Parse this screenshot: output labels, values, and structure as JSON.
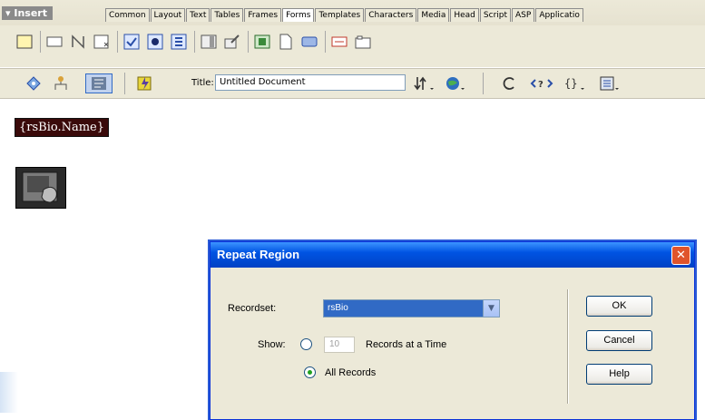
{
  "insert_bar": {
    "label": "Insert",
    "tabs": [
      "Common",
      "Layout",
      "Text",
      "Tables",
      "Frames",
      "Forms",
      "Templates",
      "Characters",
      "Media",
      "Head",
      "Script",
      "ASP",
      "Applicatio"
    ],
    "active_tab": "Forms"
  },
  "doc_toolbar": {
    "title_label": "Title:",
    "title_value": "Untitled Document"
  },
  "document": {
    "dynamic_text": "{rsBio.Name}"
  },
  "dialog": {
    "title": "Repeat Region",
    "close_glyph": "✕",
    "recordset_label": "Recordset:",
    "recordset_value": "rsBio",
    "show_label": "Show:",
    "records_count": "10",
    "records_at_time_label": "Records at a Time",
    "all_records_label": "All Records",
    "ok_label": "OK",
    "cancel_label": "Cancel",
    "help_label": "Help"
  }
}
